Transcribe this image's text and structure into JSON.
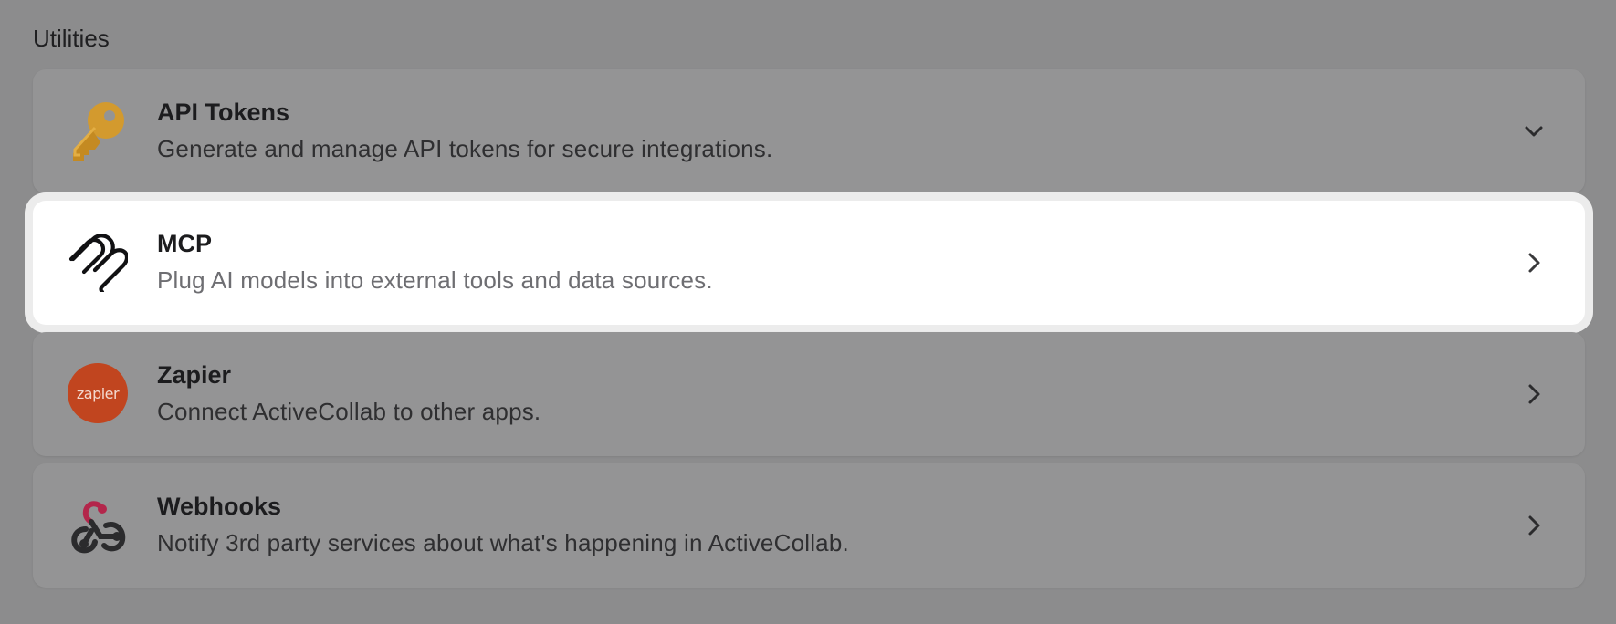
{
  "section": {
    "title": "Utilities"
  },
  "items": [
    {
      "title": "API Tokens",
      "description": "Generate and manage API tokens for secure integrations.",
      "icon": "key-icon",
      "chevron": "chevron-down-icon",
      "active": false
    },
    {
      "title": "MCP",
      "description": "Plug AI models into external tools and data sources.",
      "icon": "mcp-icon",
      "chevron": "chevron-right-icon",
      "active": true
    },
    {
      "title": "Zapier",
      "description": "Connect ActiveCollab to other apps.",
      "icon": "zapier-icon",
      "icon_text": "zapier",
      "chevron": "chevron-right-icon",
      "active": false
    },
    {
      "title": "Webhooks",
      "description": "Notify 3rd party services about what's happening in ActiveCollab.",
      "icon": "webhooks-icon",
      "chevron": "chevron-right-icon",
      "active": false
    }
  ],
  "colors": {
    "overlay_bg": "#8c8c8d",
    "card_bg": "#949495",
    "active_card_bg": "#ffffff",
    "key_color": "#d39a2e",
    "zapier_color": "#c1451f",
    "webhook_red": "#b3264b",
    "webhook_dark": "#2b2b2d"
  }
}
